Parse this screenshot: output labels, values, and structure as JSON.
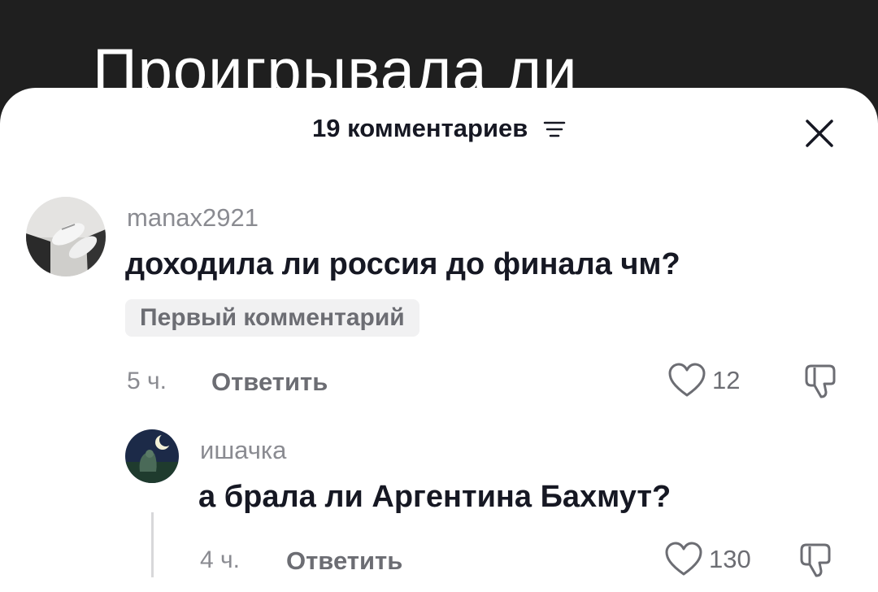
{
  "video": {
    "title": "Проигрывала ли"
  },
  "sheet": {
    "comment_count_label": "19 комментариев"
  },
  "comments": [
    {
      "username": "manax2921",
      "text": "доходила ли россия до финала чм?",
      "badge": "Первый комментарий",
      "time": "5 ч.",
      "reply_label": "Ответить",
      "likes": "12"
    },
    {
      "username": "ишачка",
      "text": "а брала ли Аргентина Бахмут?",
      "time": "4 ч.",
      "reply_label": "Ответить",
      "likes": "130"
    }
  ]
}
